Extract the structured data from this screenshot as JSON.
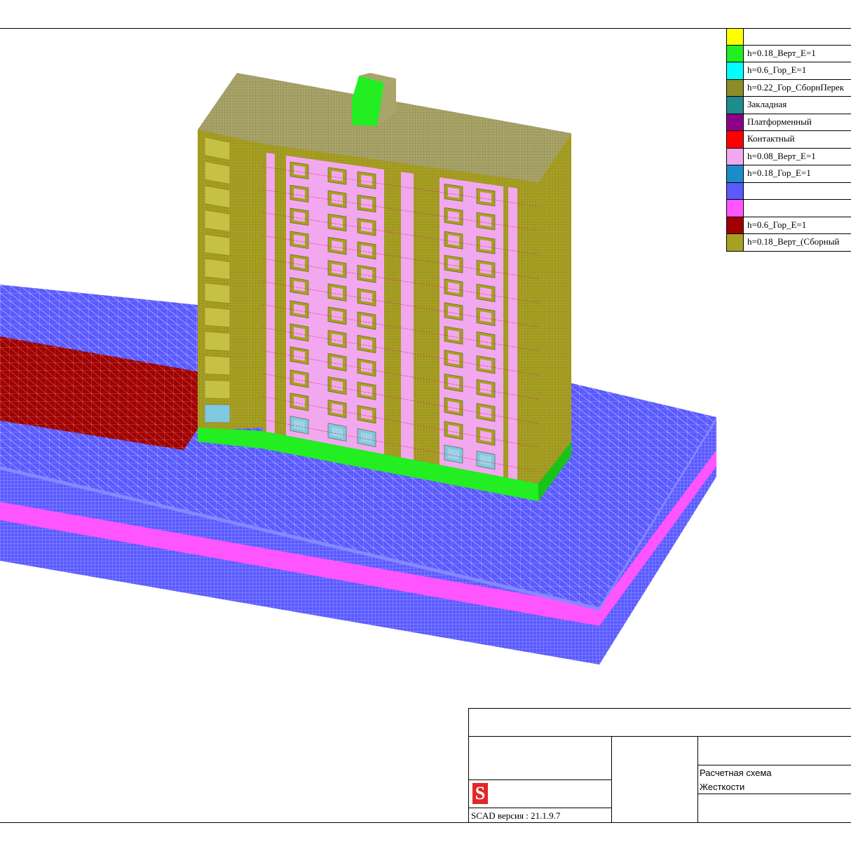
{
  "legend": [
    {
      "color": "#ffff00",
      "label": ""
    },
    {
      "color": "#22ee22",
      "label": "h=0.18_Верт_E=1"
    },
    {
      "color": "#00ffff",
      "label": "h=0.6_Гор_E=1"
    },
    {
      "color": "#8c8c28",
      "label": "h=0.22_Гор_СборнПерек"
    },
    {
      "color": "#1e8c8c",
      "label": "Закладная"
    },
    {
      "color": "#8c008c",
      "label": "Платформенный"
    },
    {
      "color": "#ff0000",
      "label": "Контактный"
    },
    {
      "color": "#f2a8ee",
      "label": "h=0.08_Верт_E=1"
    },
    {
      "color": "#1c8cc8",
      "label": "h=0.18_Гор_E=1"
    },
    {
      "color": "#5a5aff",
      "label": ""
    },
    {
      "color": "#ff55ff",
      "label": ""
    },
    {
      "color": "#a00000",
      "label": "h=0.6_Гор_E=1"
    },
    {
      "color": "#a8a020",
      "label": "h=0.18_Верт_(Сборный"
    }
  ],
  "title_block": {
    "line1": "Расчетная схема",
    "line2": "Жесткости",
    "version": "SCAD версия : 21.1.9.7",
    "logo": "S"
  },
  "colors": {
    "soil": "#5a5aff",
    "soil_layer": "#ff55ff",
    "foundation": "#a00000",
    "wall_frame": "#a8a020",
    "wall_panel": "#f2a8ee",
    "roof": "#a8a46a",
    "base_band": "#22ee22",
    "window_glass": "#7fc8e0"
  }
}
